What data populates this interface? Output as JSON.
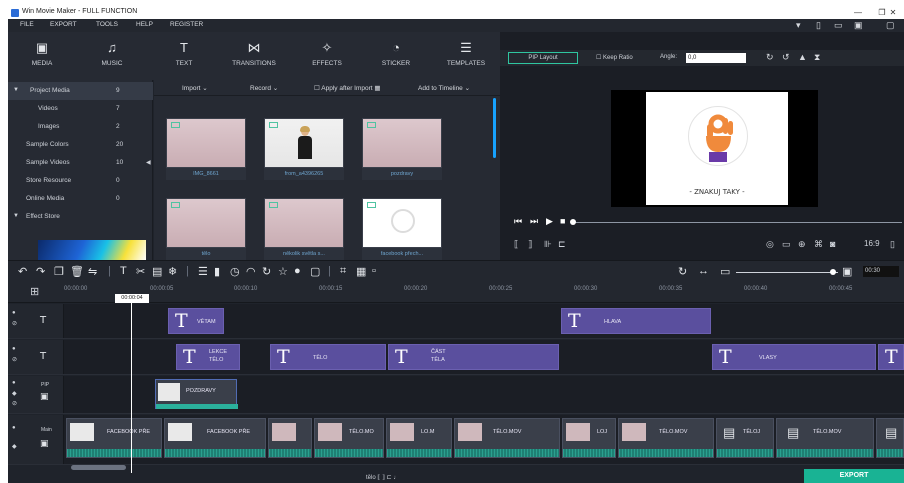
{
  "window": {
    "title": "Win Movie Maker - FULL FUNCTION",
    "controls": [
      "—",
      "❐",
      "✕"
    ]
  },
  "menu": {
    "items": [
      "FILE",
      "EXPORT",
      "TOOLS",
      "HELP",
      "REGISTER"
    ]
  },
  "toolbar": {
    "items": [
      {
        "label": "MEDIA",
        "icon": "film-icon"
      },
      {
        "label": "MUSIC",
        "icon": "music-icon"
      },
      {
        "label": "TEXT",
        "icon": "text-icon"
      },
      {
        "label": "TRANSITIONS",
        "icon": "transitions-icon"
      },
      {
        "label": "EFFECTS",
        "icon": "effects-icon"
      },
      {
        "label": "STICKER",
        "icon": "sticker-icon"
      },
      {
        "label": "TEMPLATES",
        "icon": "templates-icon"
      }
    ]
  },
  "library": {
    "items": [
      {
        "label": "Project Media",
        "count": "9"
      },
      {
        "label": "Videos",
        "count": "7"
      },
      {
        "label": "Images",
        "count": "2"
      },
      {
        "label": "Sample Colors",
        "count": "20"
      },
      {
        "label": "Sample Videos",
        "count": "10"
      },
      {
        "label": "Store Resource",
        "count": "0"
      },
      {
        "label": "Online Media",
        "count": "0"
      },
      {
        "label": "Effect Store",
        "count": ""
      }
    ]
  },
  "media": {
    "import_label": "Import",
    "record_label": "Record",
    "apply_label": "Apply after Import",
    "add_timeline_label": "Add to Timeline",
    "thumbnails": [
      {
        "caption": "IMG_8661",
        "has_person": false
      },
      {
        "caption": "from_a4396265",
        "has_person": true
      },
      {
        "caption": "pozdravy",
        "has_person": false
      },
      {
        "caption": "tělo",
        "has_person": false
      },
      {
        "caption": "několik světla s...",
        "has_person": false
      },
      {
        "caption": "facebook přech...",
        "has_person": false
      }
    ]
  },
  "preview": {
    "pip_layout_label": "PIP Layout",
    "keep_ratio_label": "Keep Ratio",
    "angle_label": "Angle:",
    "angle_value": "0,0",
    "video_caption": "- ZNAKUJ TAKY -",
    "aspect_ratio": "16:9"
  },
  "zoom": {
    "value": "00:30"
  },
  "ruler": {
    "ticks": [
      "00:00:00",
      "00:00:05",
      "00:00:10",
      "00:00:15",
      "00:00:20",
      "00:00:25",
      "00:00:30",
      "00:00:35",
      "00:00:40",
      "00:00:45"
    ],
    "playhead": "00:00:04"
  },
  "tracks": {
    "text1": [
      {
        "label": "VĚTAM"
      },
      {
        "label": "HLAVA"
      }
    ],
    "text2": [
      {
        "line1": "LEKCE",
        "line2": "TĚLO"
      },
      {
        "label": "TĚLO"
      },
      {
        "line1": "ČÁST",
        "line2": "TĚLA"
      },
      {
        "label": "VLASY"
      },
      {
        "label": ""
      }
    ],
    "pip": {
      "head_label": "PIP",
      "clip_label": "POZDRAVY"
    },
    "main": {
      "head_label": "Main",
      "clips": [
        {
          "label": "FACEBOOK PŘE"
        },
        {
          "label": "FACEBOOK PŘE"
        },
        {
          "label": ""
        },
        {
          "label": "TĚLO.MO"
        },
        {
          "label": "LO.M"
        },
        {
          "label": "TĚLO.MOV"
        },
        {
          "label": "LOJ"
        },
        {
          "label": "TĚLO.MOV"
        },
        {
          "label": "TĚLOJ"
        },
        {
          "label": "TĚLO.MOV"
        },
        {
          "label": ""
        }
      ]
    }
  },
  "status": {
    "text": "tělo"
  },
  "export_label": "EXPORT",
  "colors": {
    "accent": "#19b394",
    "text_clip": "#5a4f9e",
    "background": "#1f232b"
  }
}
